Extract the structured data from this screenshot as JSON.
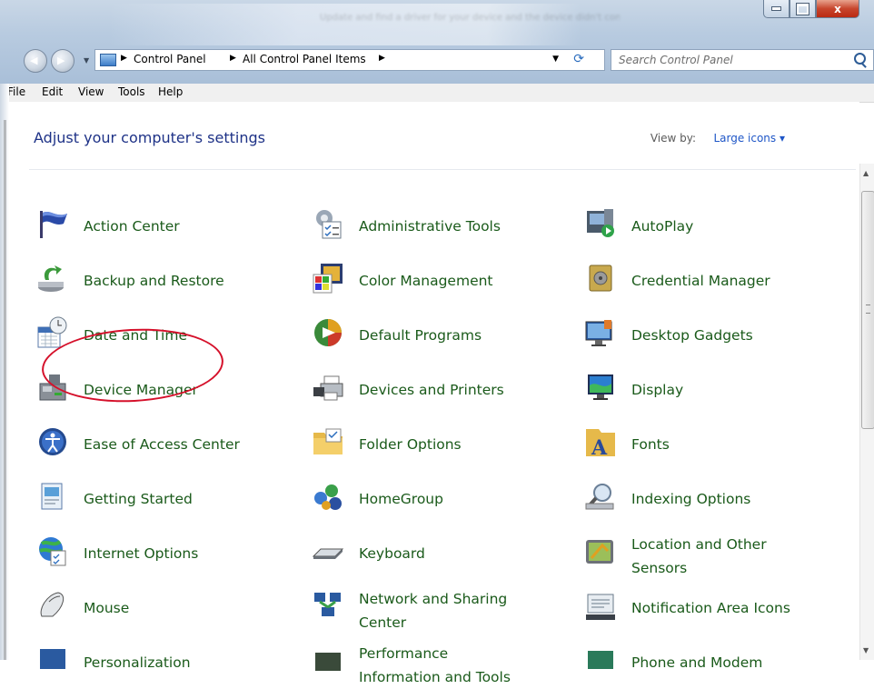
{
  "window": {
    "blurred_title": "Update and find a driver for your device and the device didn't come with software that installs a driver",
    "controls": {
      "minimize": "minimize",
      "maximize": "maximize",
      "close": "x"
    }
  },
  "nav": {
    "breadcrumb": [
      "Control Panel",
      "All Control Panel Items"
    ],
    "search_placeholder": "Search Control Panel"
  },
  "menu": [
    "File",
    "Edit",
    "View",
    "Tools",
    "Help"
  ],
  "main": {
    "title": "Adjust your computer's settings",
    "view_by_label": "View by:",
    "view_by_value": "Large icons ▾"
  },
  "items": [
    {
      "label": "Action Center",
      "icon": "flag-icon"
    },
    {
      "label": "Administrative Tools",
      "icon": "admin-tools-icon"
    },
    {
      "label": "AutoPlay",
      "icon": "autoplay-icon"
    },
    {
      "label": "Backup and Restore",
      "icon": "backup-icon"
    },
    {
      "label": "Color Management",
      "icon": "color-management-icon"
    },
    {
      "label": "Credential Manager",
      "icon": "credential-vault-icon"
    },
    {
      "label": "Date and Time",
      "icon": "calendar-clock-icon"
    },
    {
      "label": "Default Programs",
      "icon": "default-programs-icon"
    },
    {
      "label": "Desktop Gadgets",
      "icon": "gadgets-icon"
    },
    {
      "label": "Device Manager",
      "icon": "device-manager-icon"
    },
    {
      "label": "Devices and Printers",
      "icon": "printer-icon"
    },
    {
      "label": "Display",
      "icon": "display-icon"
    },
    {
      "label": "Ease of Access Center",
      "icon": "ease-of-access-icon"
    },
    {
      "label": "Folder Options",
      "icon": "folder-icon"
    },
    {
      "label": "Fonts",
      "icon": "fonts-icon"
    },
    {
      "label": "Getting Started",
      "icon": "getting-started-icon"
    },
    {
      "label": "HomeGroup",
      "icon": "homegroup-icon"
    },
    {
      "label": "Indexing Options",
      "icon": "indexing-icon"
    },
    {
      "label": "Internet Options",
      "icon": "internet-options-icon"
    },
    {
      "label": "Keyboard",
      "icon": "keyboard-icon"
    },
    {
      "label": "Location and Other Sensors",
      "icon": "sensors-icon"
    },
    {
      "label": "Mouse",
      "icon": "mouse-icon"
    },
    {
      "label": "Network and Sharing Center",
      "icon": "network-icon"
    },
    {
      "label": "Notification Area Icons",
      "icon": "notification-icon"
    },
    {
      "label": "Personalization",
      "icon": "personalization-icon"
    },
    {
      "label": "Performance Information and Tools",
      "icon": "performance-icon"
    },
    {
      "label": "Phone and Modem",
      "icon": "phone-modem-icon"
    }
  ],
  "colors": {
    "link": "#1a5a1a",
    "title": "#1e3287",
    "accent": "#1e56c7",
    "annotation": "#d5102a"
  }
}
